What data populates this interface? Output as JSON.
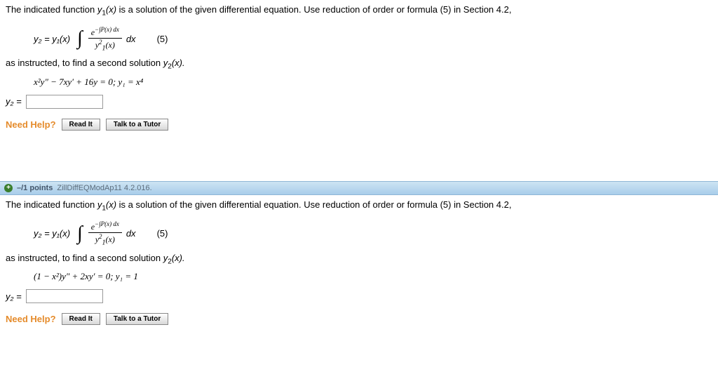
{
  "q1": {
    "prompt_pre": "The indicated function ",
    "prompt_y1": "y",
    "prompt_sub1": "1",
    "prompt_x": "(x)",
    "prompt_post": " is a solution of the given differential equation. Use reduction of order or formula (5) in Section 4.2,",
    "lhs": "y₂ = y₁(x)",
    "num": "e",
    "exp": "−∫P(x) dx",
    "den_pre": "y",
    "den_sup": "2",
    "den_sub": "1",
    "den_post": "(x)",
    "dx": "dx",
    "eqnum": "(5)",
    "instr_pre": "as instructed, to find a second solution ",
    "instr_y2": "y",
    "instr_sub2": "2",
    "instr_x": "(x).",
    "equation": "x²y″ − 7xy′ + 16y = 0;   y₁ = x⁴",
    "answer_label": "y₂ =",
    "answer_value": "",
    "help_label": "Need Help?",
    "read_btn": "Read It",
    "tutor_btn": "Talk to a Tutor"
  },
  "bar": {
    "plus": "+",
    "points": "–/1 points",
    "source": "ZillDiffEQModAp11 4.2.016."
  },
  "q2": {
    "prompt_pre": "The indicated function ",
    "prompt_y1": "y",
    "prompt_sub1": "1",
    "prompt_x": "(x)",
    "prompt_post": " is a solution of the given differential equation. Use reduction of order or formula (5) in Section 4.2,",
    "lhs": "y₂ = y₁(x)",
    "num": "e",
    "exp": "−∫P(x) dx",
    "den_pre": "y",
    "den_sup": "2",
    "den_sub": "1",
    "den_post": "(x)",
    "dx": "dx",
    "eqnum": "(5)",
    "instr_pre": "as instructed, to find a second solution ",
    "instr_y2": "y",
    "instr_sub2": "2",
    "instr_x": "(x).",
    "equation": "(1 − x²)y″ + 2xy′ = 0;   y₁ = 1",
    "answer_label": "y₂ =",
    "answer_value": "",
    "help_label": "Need Help?",
    "read_btn": "Read It",
    "tutor_btn": "Talk to a Tutor"
  }
}
